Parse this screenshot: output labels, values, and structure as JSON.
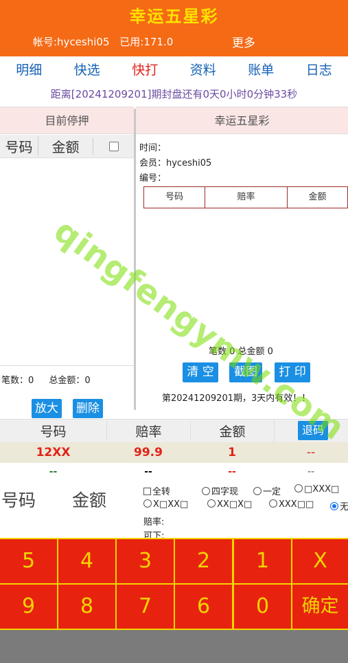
{
  "header": {
    "title": "幸运五星彩",
    "account": "帐号:hyceshi05",
    "used": "已用:171.0",
    "more": "更多"
  },
  "nav": [
    "明细",
    "快选",
    "快打",
    "资料",
    "账单",
    "日志"
  ],
  "countdown": "距离[20241209201]期封盘还有0天0小时0分钟33秒",
  "left_panel": {
    "title": "目前停押",
    "col_number": "号码",
    "col_amount": "金额",
    "sum_count": "笔数：0",
    "sum_total": "总金额：0",
    "zoom": "放大",
    "delete": "删除"
  },
  "right_panel": {
    "title": "幸运五星彩",
    "time_label": "时间：",
    "member_label": "会员：hyceshi05",
    "serial_label": "编号：",
    "col_number": "号码",
    "col_odds": "赔率",
    "col_amount": "金额",
    "summary": "笔数 0 总金额 0",
    "clear": "清 空",
    "screenshot": "截图",
    "print": "打 印",
    "period_note": "第20241209201期，3天内有效！！"
  },
  "bet_table": {
    "col_number": "号码",
    "col_odds": "赔率",
    "col_amount": "金额",
    "retreat": "退码",
    "row1": {
      "number": "12XX",
      "odds": "99.9",
      "amount": "1",
      "extra": "--"
    },
    "row2": {
      "number": "--",
      "odds": "--",
      "amount": "--",
      "extra": "--"
    }
  },
  "input_area": {
    "number_label": "号码",
    "amount_label": "金额",
    "opt_all": "全转",
    "opt_four": "四字现",
    "opt_fixed": "一定",
    "opt_pattern1": "□XXX□",
    "opt_pattern2": "X□XX□",
    "opt_pattern3": "XX□X□",
    "opt_pattern4": "XXX□□",
    "opt_none": "无",
    "odds_label": "赔率:",
    "can_place": "可下:"
  },
  "keypad": {
    "row1": [
      "5",
      "4",
      "3",
      "2",
      "1",
      "X"
    ],
    "row2": [
      "9",
      "8",
      "7",
      "6",
      "0",
      "确定"
    ]
  },
  "watermark": "qingfengymw.com",
  "colors": {
    "header": "#f56a15",
    "title": "#ffe300",
    "key_bg": "#e7230f",
    "key_text": "#f3d400",
    "blue": "#1a8fe3"
  }
}
